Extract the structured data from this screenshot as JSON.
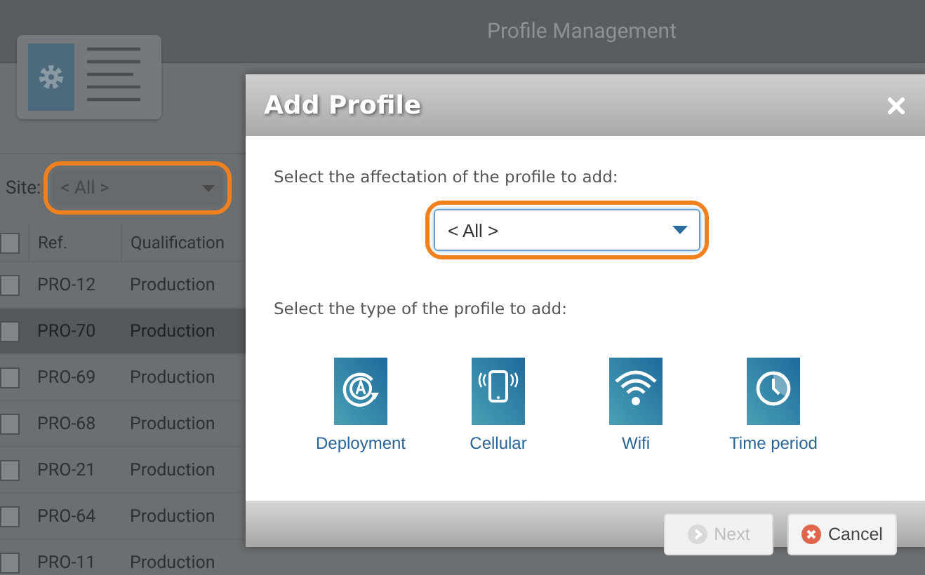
{
  "app": {
    "title": "Profile Management",
    "site_filter": {
      "label": "Site:",
      "value": "< All >",
      "highlighted": true
    },
    "table": {
      "select_all_checked": false,
      "columns": [
        "Ref.",
        "Qualification"
      ],
      "rows": [
        {
          "ref": "PRO-12",
          "qualification": "Production",
          "selected": false
        },
        {
          "ref": "PRO-70",
          "qualification": "Production",
          "selected": true
        },
        {
          "ref": "PRO-69",
          "qualification": "Production",
          "selected": false
        },
        {
          "ref": "PRO-68",
          "qualification": "Production",
          "selected": false
        },
        {
          "ref": "PRO-21",
          "qualification": "Production",
          "selected": false
        },
        {
          "ref": "PRO-64",
          "qualification": "Production",
          "selected": false
        },
        {
          "ref": "PRO-11",
          "qualification": "Production",
          "selected": false
        }
      ]
    }
  },
  "dialog": {
    "title": "Add Profile",
    "affectation_prompt": "Select the affectation of the profile to add:",
    "affectation_select": {
      "value": "< All >",
      "highlighted": true
    },
    "type_prompt": "Select the type of the profile to add:",
    "profile_types": [
      {
        "kind": "deployment",
        "label": "Deployment"
      },
      {
        "kind": "cellular",
        "label": "Cellular"
      },
      {
        "kind": "wifi",
        "label": "Wifi"
      },
      {
        "kind": "time",
        "label": "Time period"
      }
    ],
    "buttons": [
      {
        "kind": "next",
        "label": "Next",
        "disabled": true
      },
      {
        "kind": "cancel",
        "label": "Cancel",
        "disabled": false
      }
    ]
  }
}
